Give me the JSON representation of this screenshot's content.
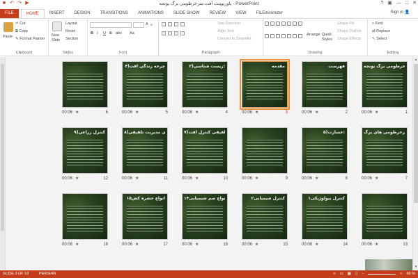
{
  "window": {
    "title": "پاورپوینت آفت سرخرطومی برگ یونجه - PowerPoint",
    "minimize": "—",
    "restore": "□",
    "close": "✕",
    "help": "?",
    "ribbon_toggle": "▣"
  },
  "tabs": [
    "FILE",
    "HOME",
    "INSERT",
    "DESIGN",
    "TRANSITIONS",
    "ANIMATIONS",
    "SLIDE SHOW",
    "REVIEW",
    "VIEW",
    "FILEminimizer"
  ],
  "active_tab": "HOME",
  "account": {
    "label": "Sign in",
    "avatar": "👤"
  },
  "ribbon": {
    "clipboard": {
      "label": "Clipboard",
      "paste": "Paste",
      "cut": "Cut",
      "copy": "Copy",
      "painter": "Format Painter"
    },
    "slides": {
      "label": "Slides",
      "new_slide": "New",
      "new_slide2": "Slide",
      "layout": "Layout",
      "reset": "Reset",
      "section": "Section"
    },
    "font": {
      "label": "Font",
      "bold": "B",
      "italic": "I",
      "underline": "U",
      "strike": "S",
      "abc": "abc",
      "grow": "A",
      "shrink": "A",
      "case": "Aa"
    },
    "paragraph": {
      "label": "Paragraph",
      "direction": "Text Direction",
      "align": "Align Text",
      "smartart": "Convert to SmartArt"
    },
    "drawing": {
      "label": "Drawing",
      "arrange": "Arrange",
      "quick": "Quick",
      "styles": "Styles",
      "fill": "Shape Fill",
      "outline": "Shape Outline",
      "effects": "Shape Effects"
    },
    "editing": {
      "label": "Editing",
      "find": "Find",
      "replace": "Replace",
      "select": "Select"
    }
  },
  "slides": [
    {
      "n": "1",
      "dur": "00:06",
      "title": "آفت سرخرطومی برگ یونجه",
      "selected": false
    },
    {
      "n": "2",
      "dur": "00:06",
      "title": "فهرست",
      "selected": false
    },
    {
      "n": "3",
      "dur": "00:06",
      "title": "مقدمه",
      "selected": true
    },
    {
      "n": "4",
      "dur": "00:06",
      "title": "۳)زیست شناسی:",
      "selected": false
    },
    {
      "n": "5",
      "dur": "00:06",
      "title": "۴)چرخه زندگی آفت",
      "selected": false
    },
    {
      "n": "6",
      "dur": "00:06",
      "title": "",
      "selected": false
    },
    {
      "n": "7",
      "dur": "00:06",
      "title": "سرخرطومی های برگ",
      "selected": false
    },
    {
      "n": "8",
      "dur": "00:06",
      "title": "۵)خسارت:",
      "selected": false
    },
    {
      "n": "9",
      "dur": "00:06",
      "title": "",
      "selected": false
    },
    {
      "n": "10",
      "dur": "00:06",
      "title": "۷)مدیریت تلفیقی کنترل آفت",
      "selected": false
    },
    {
      "n": "11",
      "dur": "00:06",
      "title": "۸)روش های مدیریت تلفیقی",
      "selected": false
    },
    {
      "n": "12",
      "dur": "00:06",
      "title": "۹)کنترل زراعی",
      "selected": false
    },
    {
      "n": "13",
      "dur": "00:06",
      "title": "",
      "selected": false
    },
    {
      "n": "14",
      "dur": "00:06",
      "title": "۱کنترل بیولوژیکی",
      "selected": false
    },
    {
      "n": "15",
      "dur": "00:06",
      "title": "۲کنترل شیمیایی",
      "selected": false
    },
    {
      "n": "16",
      "dur": "00:06",
      "title": "۱۴انواع سم شیمیایی",
      "selected": false
    },
    {
      "n": "17",
      "dur": "00:06",
      "title": "۱۵انواع حشره کش",
      "selected": false
    },
    {
      "n": "18",
      "dur": "00:06",
      "title": "",
      "selected": false
    }
  ],
  "star": "★",
  "status": {
    "slide": "SLIDE 3 OF 19",
    "language": "PERSIAN",
    "zoom": "66 %",
    "zoom_minus": "−",
    "zoom_plus": "+"
  }
}
